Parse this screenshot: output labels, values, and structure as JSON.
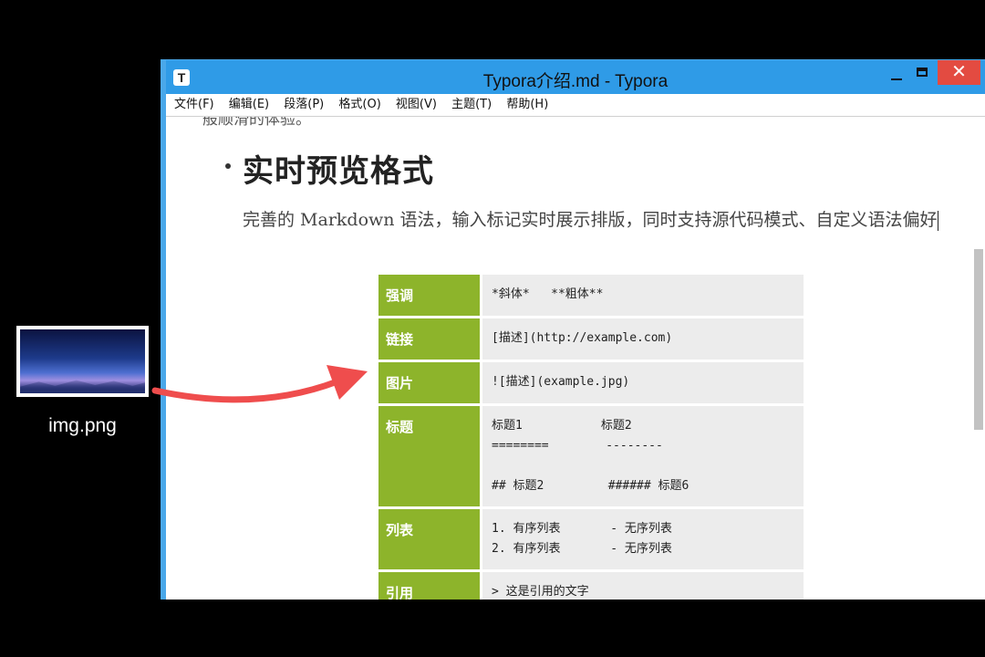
{
  "desktop": {
    "file_label": "img.png"
  },
  "window": {
    "icon_letter": "T",
    "title": "Typora介绍.md - Typora",
    "close_glyph": "✕"
  },
  "menu": [
    "文件(F)",
    "编辑(E)",
    "段落(P)",
    "格式(O)",
    "视图(V)",
    "主题(T)",
    "帮助(H)"
  ],
  "document": {
    "cut_text": "般顺滑的体验。",
    "heading": "实时预览格式",
    "paragraph": "完善的 Markdown 语法，输入标记实时展示排版，同时支持源代码模式、自定义语法偏好",
    "table": [
      {
        "label": "强调",
        "value": "*斜体*   **粗体**"
      },
      {
        "label": "链接",
        "value": "[描述](http://example.com)"
      },
      {
        "label": "图片",
        "value": "![描述](example.jpg)"
      },
      {
        "label": "标题",
        "value": "标题1           标题2\n========        --------\n\n## 标题2         ###### 标题6"
      },
      {
        "label": "列表",
        "value": "1. 有序列表       - 无序列表\n2. 有序列表       - 无序列表"
      },
      {
        "label": "引用",
        "value": "> 这是引用的文字\n> 引用内可以嵌套标题、列表等"
      }
    ]
  },
  "colors": {
    "titlebar": "#2f9be7",
    "close_button": "#e34b41",
    "table_label_bg": "#8db42b",
    "drag_arrow": "#ef4d4d"
  }
}
